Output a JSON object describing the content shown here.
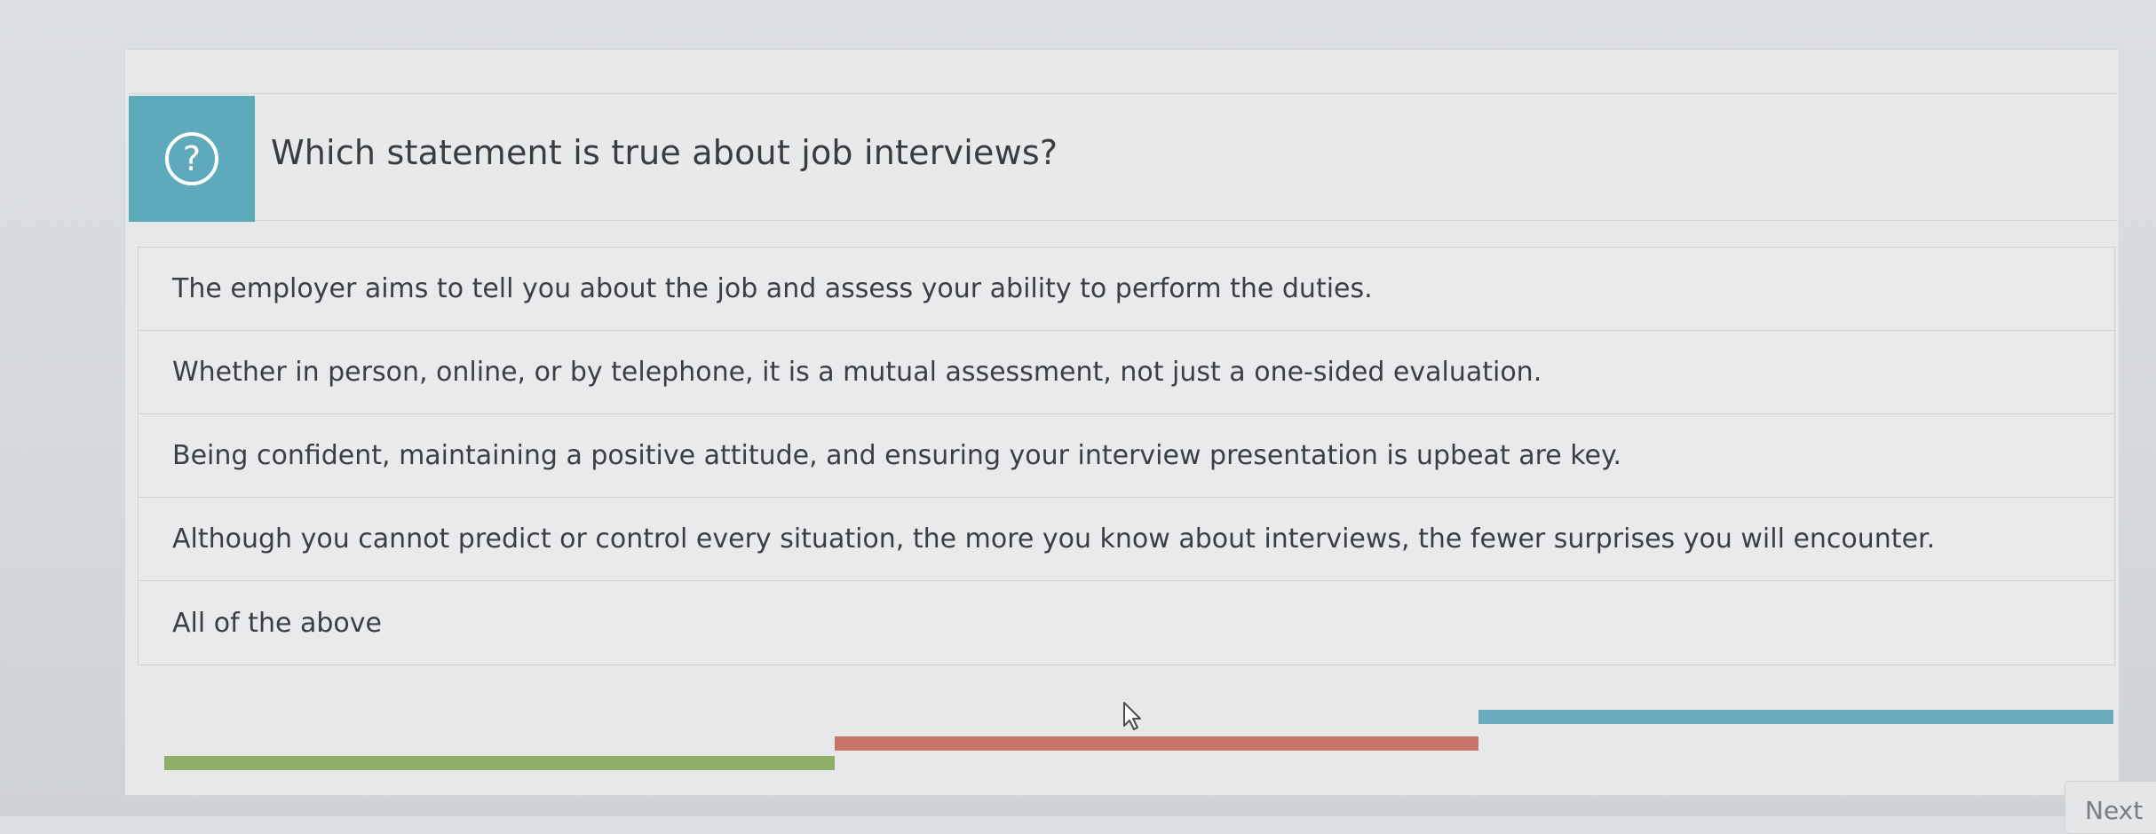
{
  "question": {
    "icon": "question-circle-icon",
    "text": "Which statement is true about job interviews?"
  },
  "answers": [
    "The employer aims to tell you about the job and assess your ability to perform the duties.",
    "Whether in person, online, or by telephone, it is a mutual assessment, not just a one-sided evaluation.",
    "Being confident, maintaining a positive attitude, and ensuring your interview presentation is upbeat are key.",
    "Although you cannot predict or control every situation, the more you know about interviews, the fewer surprises you will encounter.",
    "All of the above"
  ],
  "progress_colors": {
    "green": "#8fae67",
    "red": "#c8746a",
    "blue": "#69abbc"
  },
  "accent_color": "#5fa9bd",
  "next_label": "Next"
}
